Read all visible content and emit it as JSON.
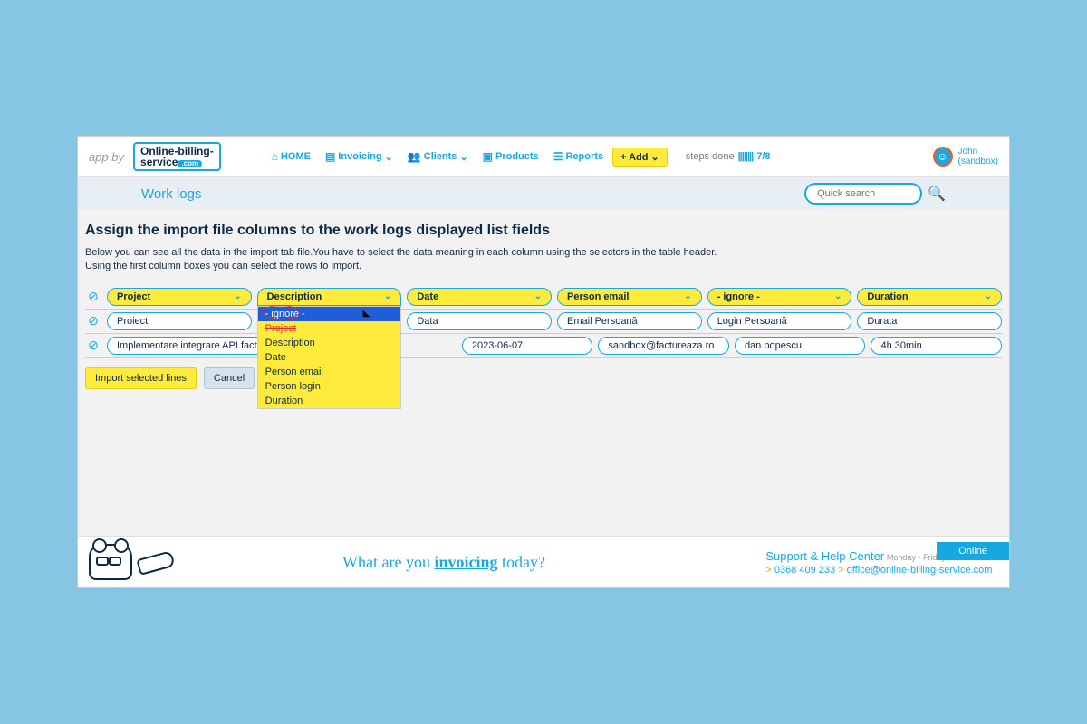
{
  "topbar": {
    "app_by": "app by",
    "logo_line1": "Online-billing-",
    "logo_line2": "service",
    "logo_badge": ".com",
    "nav": {
      "home": "HOME",
      "invoicing": "Invoicing",
      "clients": "Clients",
      "products": "Products",
      "reports": "Reports",
      "add": "+ Add"
    },
    "steps_label": "steps done",
    "steps_count": "7/8",
    "user_name": "John",
    "user_sub": "(sandbox)"
  },
  "subbar": {
    "title": "Work logs",
    "search_placeholder": "Quick search"
  },
  "page": {
    "title": "Assign the import file columns to the work logs displayed list fields",
    "desc1": "Below you can see all the data in the import tab file.You have to select the data meaning in each column using the selectors in the table header.",
    "desc2": "Using the first column boxes you can select the rows to import."
  },
  "columns": {
    "selectors": [
      "Project",
      "Description",
      "Date",
      "Person email",
      "- ignore -",
      "Duration"
    ],
    "row1": [
      "Proiect",
      "",
      "Data",
      "Email Persoană",
      "Login Persoană",
      "Durata"
    ],
    "row2": [
      "Implementare integrare API factureaza.ro », ",
      "",
      "2023-06-07",
      "sandbox@factureaza.ro",
      "dan.popescu",
      "4h 30min"
    ]
  },
  "dropdown": {
    "options": [
      "- ignore -",
      "Project",
      "Description",
      "Date",
      "Person email",
      "Person login",
      "Duration"
    ]
  },
  "actions": {
    "import": "Import selected lines",
    "cancel": "Cancel"
  },
  "footer": {
    "tagline_pre": "What are you ",
    "tagline_inv": "invoicing",
    "tagline_post": " today?",
    "help_title": "Support & Help Center",
    "help_hours": "Monday - Friday: 09:00 - 17:00",
    "help_phone": "0368 409 233",
    "help_email": "office@online-billing-service.com",
    "online": "Online"
  }
}
